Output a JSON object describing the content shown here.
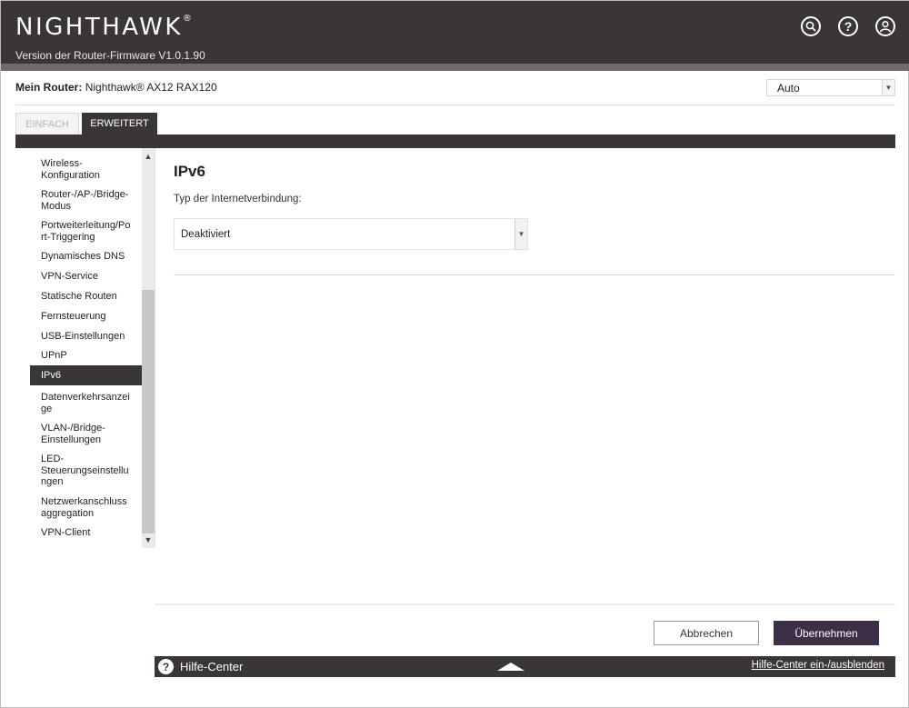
{
  "header": {
    "brand": "NIGHTHAWK",
    "brand_mark": "®",
    "firmware": "Version der Router-Firmware V1.0.1.90",
    "icons": [
      "search-icon",
      "help-icon",
      "account-icon"
    ]
  },
  "router": {
    "label": "Mein Router:",
    "model": "Nighthawk® AX12 RAX120"
  },
  "mode_select": {
    "value": "Auto"
  },
  "tabs": [
    {
      "label": "EINFACH",
      "active": false
    },
    {
      "label": "ERWEITERT",
      "active": true
    }
  ],
  "sidebar": {
    "items": [
      {
        "label": "Wireless-\nKonfiguration"
      },
      {
        "label": "Router-/AP-/Bridge-\nModus"
      },
      {
        "label": "Portweiterleitung/Po\nrt-Triggering"
      },
      {
        "label": "Dynamisches DNS"
      },
      {
        "label": "VPN-Service"
      },
      {
        "label": "Statische Routen"
      },
      {
        "label": "Fernsteuerung"
      },
      {
        "label": "USB-Einstellungen"
      },
      {
        "label": "UPnP"
      },
      {
        "label": "IPv6",
        "active": true
      },
      {
        "label": "Datenverkehrsanzei\nge"
      },
      {
        "label": "VLAN-/Bridge-\nEinstellungen"
      },
      {
        "label": "LED-\nSteuerungseinstellu\nngen"
      },
      {
        "label": "Netzwerkanschluss\naggregation"
      },
      {
        "label": "VPN-Client"
      }
    ]
  },
  "main": {
    "title": "IPv6",
    "connection_type_label": "Typ der Internetverbindung:",
    "connection_type_value": "Deaktiviert"
  },
  "buttons": {
    "cancel": "Abbrechen",
    "apply": "Übernehmen"
  },
  "helpbar": {
    "label": "Hilfe-Center",
    "toggle": "Hilfe-Center ein-/ausblenden"
  },
  "colors": {
    "header_bg": "#3a3537",
    "accent_button": "#3d2f45"
  }
}
